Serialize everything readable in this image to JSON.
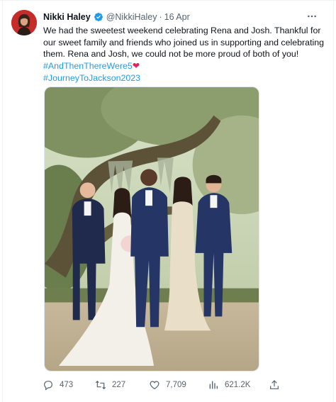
{
  "tweet": {
    "author_name": "Nikki Haley",
    "handle": "@NikkiHaley",
    "separator": "·",
    "date": "16 Apr",
    "text_lines": [
      "We had the sweetest weekend celebrating Rena and Josh. Thankful for",
      "our sweet family and friends who joined us in supporting and celebrating",
      "them. Rena and Josh, we could not be more proud of both of you!"
    ],
    "hashtag_1": "#AndThenThereWere5",
    "hashtag_1_emoji": "❤",
    "hashtag_2": "#JourneyToJackson2023",
    "image_icon": "wedding-group-photo"
  },
  "actions": {
    "replies": {
      "icon": "reply-icon",
      "count": "473"
    },
    "retweets": {
      "icon": "retweet-icon",
      "count": "227"
    },
    "likes": {
      "icon": "like-icon",
      "count": "7,709"
    },
    "views": {
      "icon": "views-icon",
      "count": "621.2K"
    },
    "share": {
      "icon": "share-icon"
    }
  },
  "colors": {
    "text": "#0f1419",
    "secondary": "#536471",
    "link": "#1d9bf0",
    "verified": "#1d9bf0",
    "heart": "#e0245e"
  }
}
